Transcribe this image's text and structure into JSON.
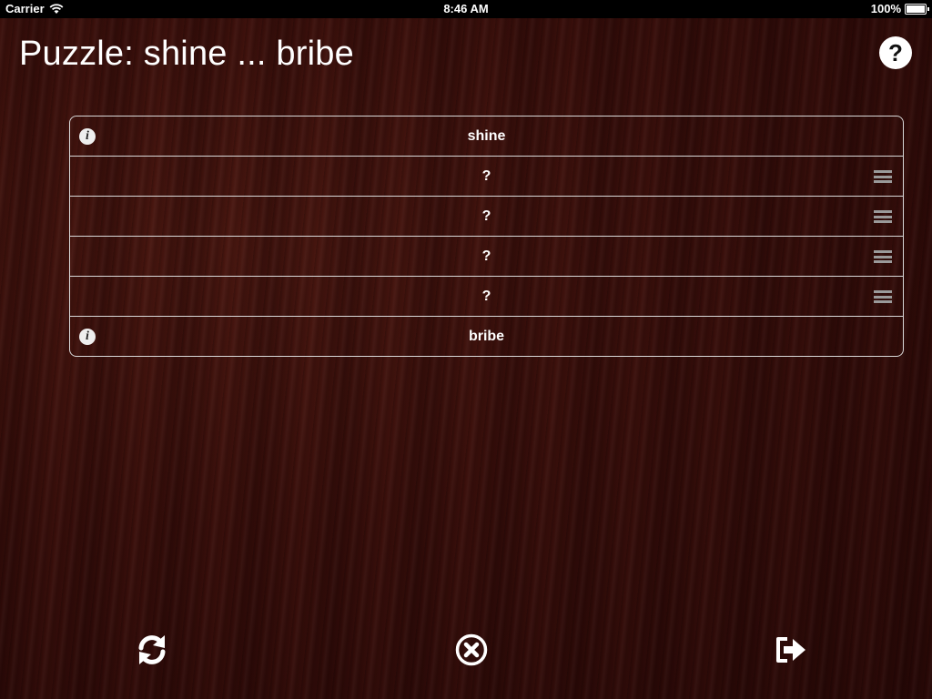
{
  "status_bar": {
    "carrier": "Carrier",
    "time": "8:46 AM",
    "battery": "100%",
    "battery_level": 1.0
  },
  "header": {
    "title": "Puzzle: shine ... bribe",
    "help_icon": "question-circle-icon",
    "help_glyph": "?"
  },
  "words": [
    {
      "label": "shine",
      "kind": "fixed",
      "icon": "info-icon"
    },
    {
      "label": "?",
      "kind": "unknown",
      "icon": "grip-icon"
    },
    {
      "label": "?",
      "kind": "unknown",
      "icon": "grip-icon"
    },
    {
      "label": "?",
      "kind": "unknown",
      "icon": "grip-icon"
    },
    {
      "label": "?",
      "kind": "unknown",
      "icon": "grip-icon"
    },
    {
      "label": "bribe",
      "kind": "fixed",
      "icon": "info-icon"
    }
  ],
  "info_glyph": "i",
  "toolbar": {
    "refresh_icon": "refresh-icon",
    "clear_icon": "close-circle-icon",
    "exit_icon": "exit-icon"
  },
  "colors": {
    "background": "#3a0f0b",
    "text": "#ffffff",
    "row_border": "#d8d8d8",
    "grip": "#9a9a9a"
  }
}
